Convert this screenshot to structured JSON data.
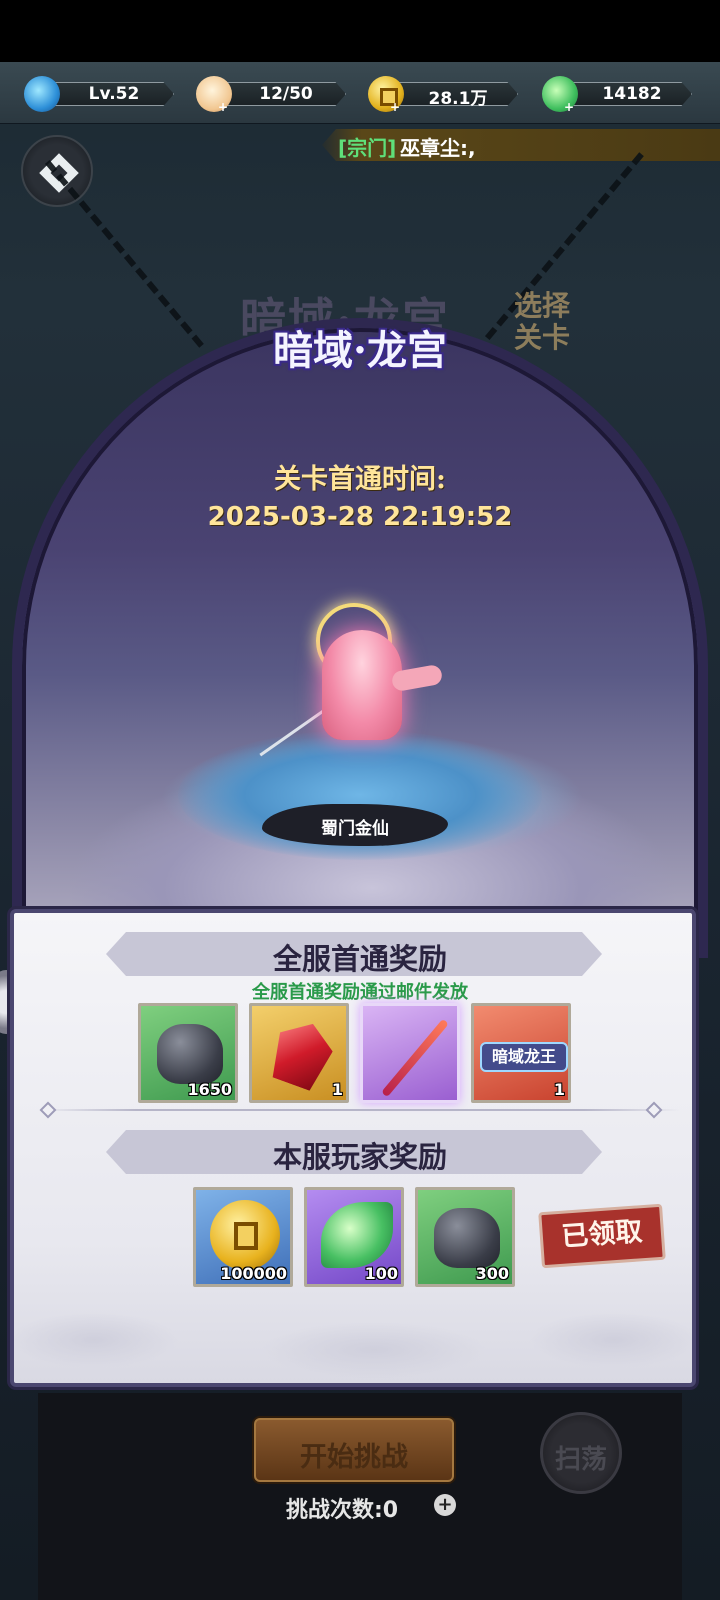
{
  "resources": {
    "level": "Lv.52",
    "stamina": "12/50",
    "coins": "28.1万",
    "jade": "14182"
  },
  "chat": {
    "channel": "[宗门]",
    "message": "巫章尘:,"
  },
  "stage": {
    "bg_title": "暗域·龙宫",
    "select_stage_label": "选择关卡",
    "title": "暗域·龙宫",
    "first_clear_label": "关卡首通时间:",
    "first_clear_time": "2025-03-28 22:19:52",
    "hero_name": "蜀门金仙"
  },
  "rewards": {
    "server_first_title": "全服首通奖励",
    "mail_note": "全服首通奖励通过邮件发放",
    "server_first_items": [
      {
        "icon": "ore-rock-icon",
        "count": "1650"
      },
      {
        "icon": "red-gem-icon",
        "count": "1"
      },
      {
        "icon": "sword-icon",
        "count": ""
      },
      {
        "icon": "title-badge-icon",
        "badge_text": "暗域龙王",
        "count": "1"
      }
    ],
    "player_title": "本服玩家奖励",
    "player_items": [
      {
        "icon": "gold-coin-icon",
        "count": "100000"
      },
      {
        "icon": "jade-leaf-icon",
        "count": "100"
      },
      {
        "icon": "ore-rock-icon",
        "count": "300"
      }
    ],
    "claimed_label": "已领取"
  },
  "controls": {
    "start_label": "开始挑战",
    "sweep_label": "扫荡",
    "attempts_label": "挑战次数:0"
  }
}
